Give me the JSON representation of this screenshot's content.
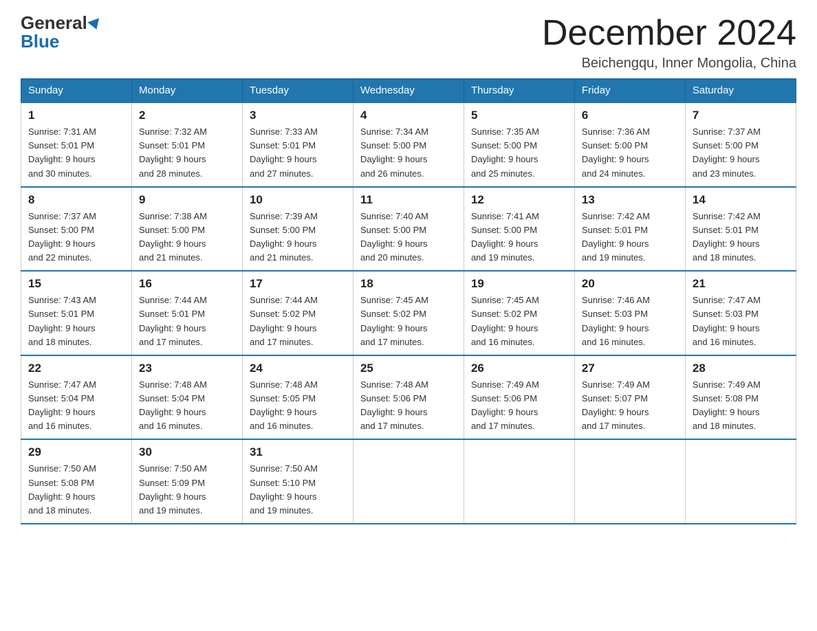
{
  "header": {
    "logo_general": "General",
    "logo_blue": "Blue",
    "month_title": "December 2024",
    "location": "Beichengqu, Inner Mongolia, China"
  },
  "weekdays": [
    "Sunday",
    "Monday",
    "Tuesday",
    "Wednesday",
    "Thursday",
    "Friday",
    "Saturday"
  ],
  "weeks": [
    [
      {
        "day": "1",
        "sunrise": "7:31 AM",
        "sunset": "5:01 PM",
        "daylight": "9 hours and 30 minutes."
      },
      {
        "day": "2",
        "sunrise": "7:32 AM",
        "sunset": "5:01 PM",
        "daylight": "9 hours and 28 minutes."
      },
      {
        "day": "3",
        "sunrise": "7:33 AM",
        "sunset": "5:01 PM",
        "daylight": "9 hours and 27 minutes."
      },
      {
        "day": "4",
        "sunrise": "7:34 AM",
        "sunset": "5:00 PM",
        "daylight": "9 hours and 26 minutes."
      },
      {
        "day": "5",
        "sunrise": "7:35 AM",
        "sunset": "5:00 PM",
        "daylight": "9 hours and 25 minutes."
      },
      {
        "day": "6",
        "sunrise": "7:36 AM",
        "sunset": "5:00 PM",
        "daylight": "9 hours and 24 minutes."
      },
      {
        "day": "7",
        "sunrise": "7:37 AM",
        "sunset": "5:00 PM",
        "daylight": "9 hours and 23 minutes."
      }
    ],
    [
      {
        "day": "8",
        "sunrise": "7:37 AM",
        "sunset": "5:00 PM",
        "daylight": "9 hours and 22 minutes."
      },
      {
        "day": "9",
        "sunrise": "7:38 AM",
        "sunset": "5:00 PM",
        "daylight": "9 hours and 21 minutes."
      },
      {
        "day": "10",
        "sunrise": "7:39 AM",
        "sunset": "5:00 PM",
        "daylight": "9 hours and 21 minutes."
      },
      {
        "day": "11",
        "sunrise": "7:40 AM",
        "sunset": "5:00 PM",
        "daylight": "9 hours and 20 minutes."
      },
      {
        "day": "12",
        "sunrise": "7:41 AM",
        "sunset": "5:00 PM",
        "daylight": "9 hours and 19 minutes."
      },
      {
        "day": "13",
        "sunrise": "7:42 AM",
        "sunset": "5:01 PM",
        "daylight": "9 hours and 19 minutes."
      },
      {
        "day": "14",
        "sunrise": "7:42 AM",
        "sunset": "5:01 PM",
        "daylight": "9 hours and 18 minutes."
      }
    ],
    [
      {
        "day": "15",
        "sunrise": "7:43 AM",
        "sunset": "5:01 PM",
        "daylight": "9 hours and 18 minutes."
      },
      {
        "day": "16",
        "sunrise": "7:44 AM",
        "sunset": "5:01 PM",
        "daylight": "9 hours and 17 minutes."
      },
      {
        "day": "17",
        "sunrise": "7:44 AM",
        "sunset": "5:02 PM",
        "daylight": "9 hours and 17 minutes."
      },
      {
        "day": "18",
        "sunrise": "7:45 AM",
        "sunset": "5:02 PM",
        "daylight": "9 hours and 17 minutes."
      },
      {
        "day": "19",
        "sunrise": "7:45 AM",
        "sunset": "5:02 PM",
        "daylight": "9 hours and 16 minutes."
      },
      {
        "day": "20",
        "sunrise": "7:46 AM",
        "sunset": "5:03 PM",
        "daylight": "9 hours and 16 minutes."
      },
      {
        "day": "21",
        "sunrise": "7:47 AM",
        "sunset": "5:03 PM",
        "daylight": "9 hours and 16 minutes."
      }
    ],
    [
      {
        "day": "22",
        "sunrise": "7:47 AM",
        "sunset": "5:04 PM",
        "daylight": "9 hours and 16 minutes."
      },
      {
        "day": "23",
        "sunrise": "7:48 AM",
        "sunset": "5:04 PM",
        "daylight": "9 hours and 16 minutes."
      },
      {
        "day": "24",
        "sunrise": "7:48 AM",
        "sunset": "5:05 PM",
        "daylight": "9 hours and 16 minutes."
      },
      {
        "day": "25",
        "sunrise": "7:48 AM",
        "sunset": "5:06 PM",
        "daylight": "9 hours and 17 minutes."
      },
      {
        "day": "26",
        "sunrise": "7:49 AM",
        "sunset": "5:06 PM",
        "daylight": "9 hours and 17 minutes."
      },
      {
        "day": "27",
        "sunrise": "7:49 AM",
        "sunset": "5:07 PM",
        "daylight": "9 hours and 17 minutes."
      },
      {
        "day": "28",
        "sunrise": "7:49 AM",
        "sunset": "5:08 PM",
        "daylight": "9 hours and 18 minutes."
      }
    ],
    [
      {
        "day": "29",
        "sunrise": "7:50 AM",
        "sunset": "5:08 PM",
        "daylight": "9 hours and 18 minutes."
      },
      {
        "day": "30",
        "sunrise": "7:50 AM",
        "sunset": "5:09 PM",
        "daylight": "9 hours and 19 minutes."
      },
      {
        "day": "31",
        "sunrise": "7:50 AM",
        "sunset": "5:10 PM",
        "daylight": "9 hours and 19 minutes."
      },
      null,
      null,
      null,
      null
    ]
  ]
}
